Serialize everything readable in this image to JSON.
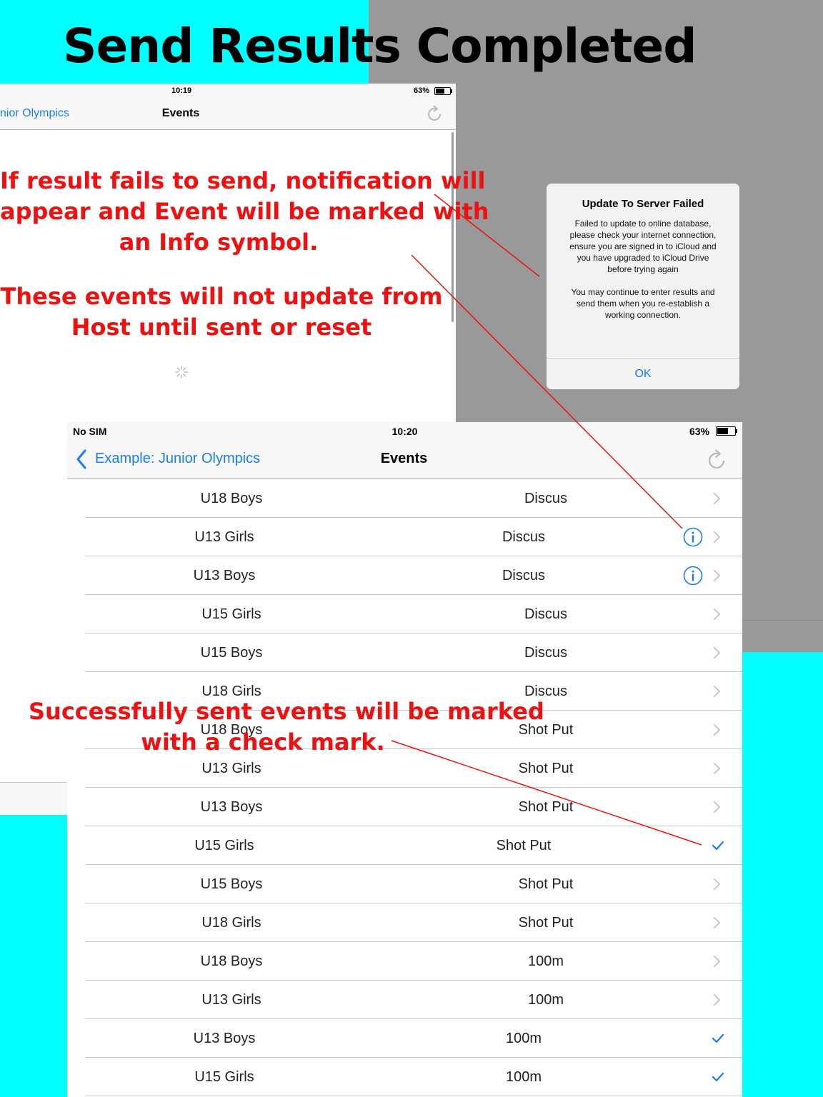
{
  "title": "Send Results Completed",
  "back_screen": {
    "status": {
      "time": "10:19",
      "battery": "63%"
    },
    "nav": {
      "back_label": "nior Olympics",
      "title": "Events"
    }
  },
  "annotations": {
    "fail_line1": "If result fails to send, notification will",
    "fail_line2": "appear and Event will be marked with",
    "fail_line3": "an Info symbol.",
    "host_line1": "These events will not update from",
    "host_line2": "Host until sent or reset",
    "success_line1": "Successfully sent events will be marked",
    "success_line2": "with a check mark."
  },
  "dialog": {
    "title": "Update To Server Failed",
    "message_lines": [
      "Failed to update to online database,",
      "please check your internet connection,",
      "ensure you are signed in to iCloud and",
      "you have upgraded to iCloud Drive",
      "before trying again"
    ],
    "message2_lines": [
      "You may continue to enter results and",
      "send them when you re-establish a",
      "working connection."
    ],
    "ok_label": "OK"
  },
  "front_screen": {
    "status": {
      "carrier": "No SIM",
      "time": "10:20",
      "battery": "63%"
    },
    "nav": {
      "back_label": "Example: Junior Olympics",
      "title": "Events"
    },
    "rows": [
      {
        "group": "U18 Boys",
        "event": "Discus",
        "status": "chevron"
      },
      {
        "group": "U13 Girls",
        "event": "Discus",
        "status": "info"
      },
      {
        "group": "U13 Boys",
        "event": "Discus",
        "status": "info"
      },
      {
        "group": "U15 Girls",
        "event": "Discus",
        "status": "chevron"
      },
      {
        "group": "U15 Boys",
        "event": "Discus",
        "status": "chevron"
      },
      {
        "group": "U18 Girls",
        "event": "Discus",
        "status": "chevron"
      },
      {
        "group": "U18 Boys",
        "event": "Shot Put",
        "status": "chevron"
      },
      {
        "group": "U13 Girls",
        "event": "Shot Put",
        "status": "chevron"
      },
      {
        "group": "U13 Boys",
        "event": "Shot Put",
        "status": "chevron"
      },
      {
        "group": "U15 Girls",
        "event": "Shot Put",
        "status": "check"
      },
      {
        "group": "U15 Boys",
        "event": "Shot Put",
        "status": "chevron"
      },
      {
        "group": "U18 Girls",
        "event": "Shot Put",
        "status": "chevron"
      },
      {
        "group": "U18 Boys",
        "event": "100m",
        "status": "chevron"
      },
      {
        "group": "U13 Girls",
        "event": "100m",
        "status": "chevron"
      },
      {
        "group": "U13 Boys",
        "event": "100m",
        "status": "check"
      },
      {
        "group": "U15 Girls",
        "event": "100m",
        "status": "check"
      }
    ]
  },
  "colors": {
    "cyan": "#00ffff",
    "gray_background": "#999999",
    "ios_blue": "#1a7cf9",
    "annotation_red": "#ee1111"
  }
}
